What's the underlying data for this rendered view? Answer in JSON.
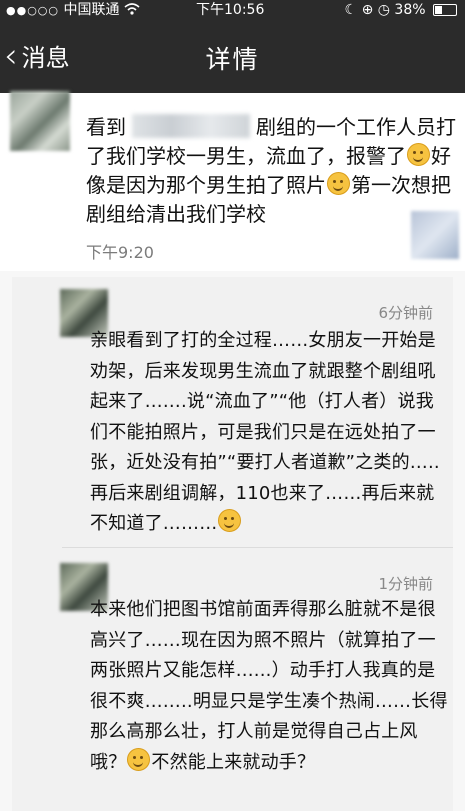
{
  "status_bar": {
    "signal": "●●○○○",
    "carrier": "中国联通",
    "wifi_icon": "wifi-icon",
    "time": "下午10:56",
    "battery_pct": "38%",
    "battery_fill": 0.38
  },
  "nav": {
    "back_label": "消息",
    "title": "详情"
  },
  "post": {
    "text_part1": "看到",
    "text_part2": "剧组的一个工作人员打了我们学校一男生，流血了，报警了",
    "text_part3": "好像是因为那个男生拍了照片",
    "text_part4": "第一次想把剧组给清出我们学校",
    "time": "下午9:20"
  },
  "comments": [
    {
      "time": "6分钟前",
      "text": "亲眼看到了打的全过程……女朋友一开始是劝架，后来发现男生流血了就跟整个剧组吼起来了…….说“流血了”“他（打人者）说我们不能拍照片，可是我们只是在远处拍了一张，近处没有拍”“要打人者道歉”之类的…..再后来剧组调解，110也来了……再后来就不知道了………"
    },
    {
      "time": "1分钟前",
      "text_part1": "本来他们把图书馆前面弄得那么脏就不是很高兴了……现在因为照不照片（就算拍了一两张照片又能怎样…...）动手打人我真的是很不爽……..明显只是学生凑个热闹……长得那么高那么壮，打人前是觉得自己占上风哦？",
      "text_part2": "不然能上来就动手？"
    }
  ]
}
